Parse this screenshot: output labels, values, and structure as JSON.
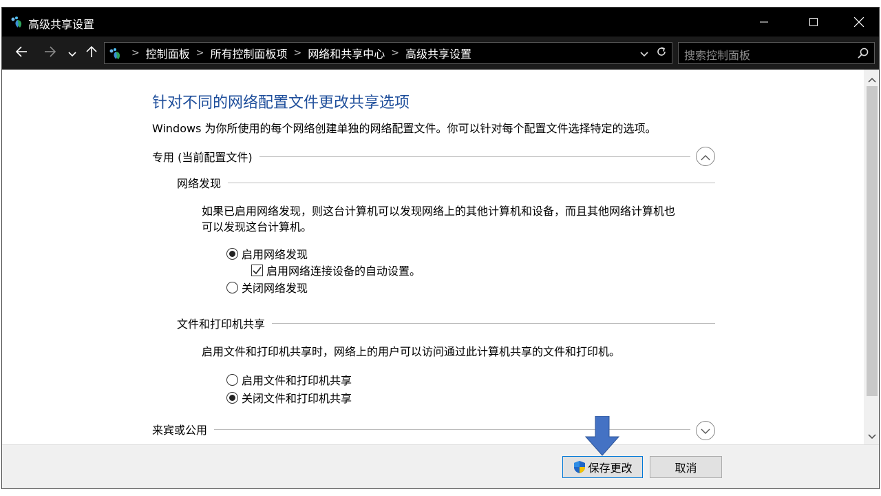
{
  "window": {
    "title": "高级共享设置",
    "controls": {
      "minimize": "minimize-icon",
      "maximize": "maximize-icon",
      "close": "close-icon"
    }
  },
  "navigation": {
    "back": "arrow-left-icon",
    "forward": "arrow-right-icon",
    "recent": "chevron-down-icon",
    "up": "arrow-up-icon"
  },
  "address": {
    "breadcrumbs": [
      "控制面板",
      "所有控制面板项",
      "网络和共享中心",
      "高级共享设置"
    ],
    "separator": ">"
  },
  "search": {
    "placeholder": "搜索控制面板"
  },
  "main": {
    "heading": "针对不同的网络配置文件更改共享选项",
    "subtitle": "Windows 为你所使用的每个网络创建单独的网络配置文件。你可以针对每个配置文件选择特定的选项。",
    "profiles": {
      "private": {
        "label": "专用 (当前配置文件)",
        "expanded": true,
        "network_discovery": {
          "label": "网络发现",
          "desc_line1": "如果已启用网络发现，则这台计算机可以发现网络上的其他计算机和设备，而且其他网络计算机也",
          "desc_line2": "可以发现这台计算机。",
          "on_label": "启用网络发现",
          "auto_setup_label": "启用网络连接设备的自动设置。",
          "off_label": "关闭网络发现",
          "selected": "on",
          "auto_setup_checked": true
        },
        "file_printer_sharing": {
          "label": "文件和打印机共享",
          "desc": "启用文件和打印机共享时，网络上的用户可以访问通过此计算机共享的文件和打印机。",
          "on_label": "启用文件和打印机共享",
          "off_label": "关闭文件和打印机共享",
          "selected": "off"
        }
      },
      "guest_public": {
        "label": "来宾或公用",
        "expanded": false
      }
    }
  },
  "footer": {
    "save_label": "保存更改",
    "cancel_label": "取消"
  },
  "colors": {
    "heading": "#1e4e9b",
    "titlebar": "#000000",
    "annotation_arrow": "#4472c4"
  }
}
